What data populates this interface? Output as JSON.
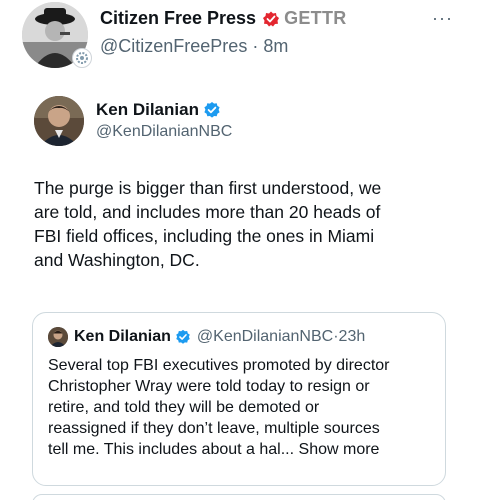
{
  "post": {
    "author_name": "Citizen Free Press",
    "badge_label": "GETTR",
    "author_handle": "@CitizenFreePres",
    "separator": "·",
    "time_ago": "8m",
    "more_label": "···"
  },
  "tweet": {
    "author_name": "Ken Dilanian",
    "author_handle": "@KenDilanianNBC",
    "body_lines": [
      "The purge is bigger than first understood, we",
      "are told, and includes more than 20 heads of",
      "FBI field offices, including the ones in Miami",
      "and Washington, DC."
    ]
  },
  "quoted": {
    "author_name": "Ken Dilanian",
    "author_handle": "@KenDilanianNBC",
    "separator": "·",
    "time_ago": "23h",
    "body_lines": [
      "Several top FBI executives promoted by director",
      "Christopher Wray were told today to resign or",
      "retire, and told they will be demoted or",
      "reassigned if they don’t leave, multiple sources"
    ],
    "last_line": "tell me. This includes about a hal...",
    "show_more": "Show more"
  },
  "icons": {
    "verified": "verified-badge-icon",
    "gettr": "gettr-logo-icon",
    "more": "more-horizontal-icon"
  },
  "colors": {
    "verified_blue": "#1d9bf0",
    "gettr_red": "#e3262f",
    "secondary_text": "#536471",
    "border": "#cfd9de"
  }
}
